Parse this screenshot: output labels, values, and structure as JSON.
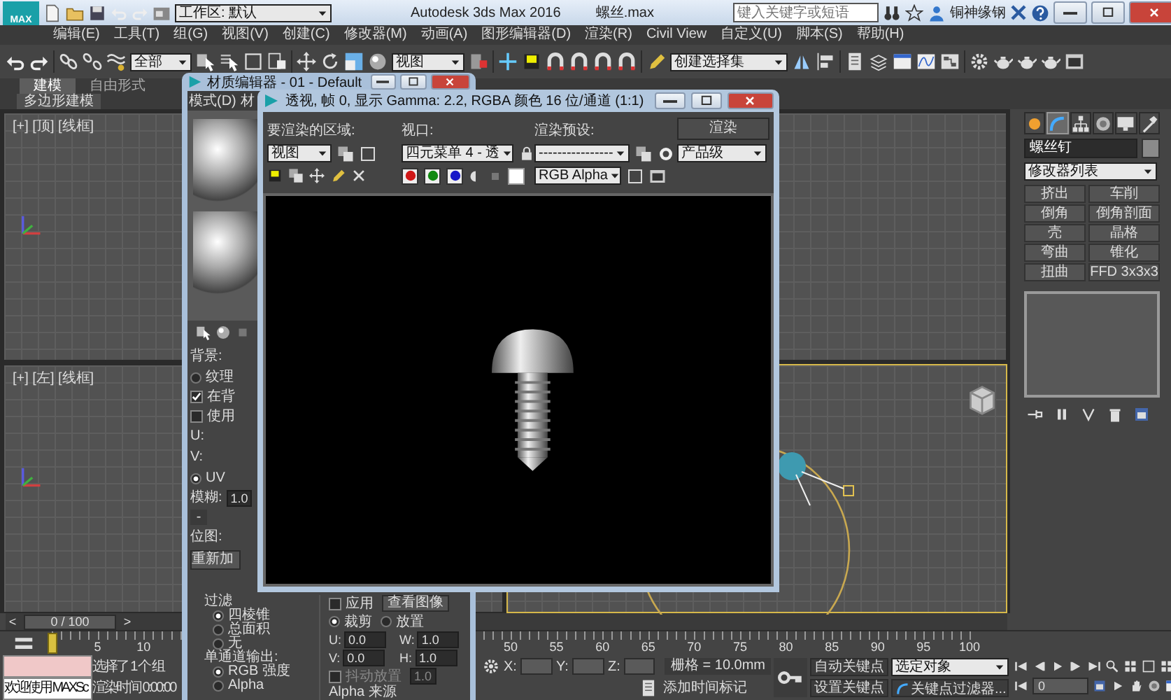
{
  "main_window": {
    "logo": "MAX",
    "workspace": "工作区: 默认",
    "title": "Autodesk 3ds Max 2016",
    "file": "螺丝.max",
    "search": {
      "placeholder": "键入关键字或短语"
    },
    "user": "铜神缘钢",
    "menu": [
      "编辑(E)",
      "工具(T)",
      "组(G)",
      "视图(V)",
      "创建(C)",
      "修改器(M)",
      "动画(A)",
      "图形编辑器(D)",
      "渲染(R)",
      "Civil View",
      "自定义(U)",
      "脚本(S)",
      "帮助(H)"
    ],
    "toolbar": {
      "selection_filter": "全部",
      "reference_coordinate": "视图",
      "named_selection": "创建选择集"
    },
    "ribbon": {
      "tabs": [
        {
          "label": "建模",
          "selected": true
        },
        {
          "label": "自由形式",
          "selected": false
        }
      ],
      "panel": "多边形建模"
    },
    "viewports": [
      {
        "label": "[+] [顶] [线框]",
        "active": false
      },
      {
        "active": false
      },
      {
        "label": "[+] [左] [线框]",
        "active": false
      },
      {
        "active": true
      }
    ],
    "command_panel": {
      "tabs": [
        {
          "selected": false
        },
        {
          "selected": true
        },
        {
          "selected": false
        },
        {
          "selected": false
        },
        {
          "selected": false
        },
        {
          "selected": false
        }
      ],
      "object_name": "螺丝钉",
      "modifier_list": "修改器列表",
      "modifiers": [
        "挤出",
        "车削",
        "倒角",
        "倒角剖面",
        "壳",
        "晶格",
        "弯曲",
        "锥化",
        "扭曲",
        "FFD 3x3x3"
      ]
    },
    "time_slider": {
      "prev": "<",
      "reading": "0 / 100",
      "next": ">",
      "level": 0
    },
    "track_bar": {
      "ticks": [
        "5",
        "10",
        "50",
        "55",
        "60",
        "65",
        "70",
        "75",
        "80",
        "85",
        "90",
        "95",
        "100"
      ]
    },
    "status": {
      "listener_message": "欢迎使用 MAXSc",
      "selection": "选择了 1 个 组",
      "render_time": "渲染时间 0:00:00",
      "coords": [
        "X:",
        "Y:",
        "Z:"
      ],
      "grid": "栅格 = 10.0mm",
      "add_time_tag": "添加时间标记",
      "auto_key": "自动关键点",
      "key_mode": "选定对象",
      "set_key": "设置关键点",
      "key_filters": "关键点过滤器...",
      "current_frame": "0"
    }
  },
  "material_editor": {
    "title": "材质编辑器 - 01 - Default",
    "menu": [
      "模式(D)",
      "材"
    ],
    "params": [
      {
        "kind": "label",
        "text": "背景:"
      },
      {
        "kind": "radio",
        "text": "纹理",
        "selected": false
      },
      {
        "kind": "checkbox",
        "text": "在背",
        "checked": true
      },
      {
        "kind": "checkbox",
        "text": "使用",
        "checked": false
      },
      {
        "kind": "label",
        "text": "U:"
      },
      {
        "kind": "label",
        "text": "V:"
      },
      {
        "kind": "radio",
        "text": "UV",
        "selected": true
      },
      {
        "kind": "spinner",
        "text": "模糊:",
        "value": "1.0"
      },
      {
        "kind": "rollout",
        "text": "-"
      },
      {
        "kind": "label",
        "text": "位图:"
      },
      {
        "kind": "button",
        "text": "重新加"
      }
    ],
    "filtering": {
      "title": "过滤",
      "options": [
        {
          "label": "四棱锥",
          "selected": true
        },
        {
          "label": "总面积",
          "selected": false
        },
        {
          "label": "无",
          "selected": false
        }
      ]
    },
    "mono_output": {
      "title": "单通道输出:",
      "options": [
        {
          "label": "RGB 强度",
          "selected": true
        },
        {
          "label": "Alpha",
          "selected": false
        }
      ]
    },
    "cropping": {
      "apply": {
        "label": "应用",
        "checked": false
      },
      "view_image": "查看图像",
      "modes": [
        {
          "label": "裁剪",
          "selected": true
        },
        {
          "label": "放置",
          "selected": false
        }
      ],
      "spinners": [
        {
          "label": "U:",
          "value": "0.0"
        },
        {
          "label": "W:",
          "value": "1.0"
        },
        {
          "label": "V:",
          "value": "0.0"
        },
        {
          "label": "H:",
          "value": "1.0"
        }
      ],
      "jitter": {
        "label": "抖动放置",
        "checked": false,
        "value": "1.0"
      }
    },
    "alpha_source": {
      "title": "Alpha 来源"
    }
  },
  "render_frame": {
    "title": "透视, 帧 0, 显示 Gamma: 2.2, RGBA 颜色 16 位/通道 (1:1)",
    "area": {
      "label": "要渲染的区域:",
      "value": "视图"
    },
    "viewport": {
      "label": "视口:",
      "value": "四元菜单 4 - 透"
    },
    "preset": {
      "label": "渲染预设:",
      "value": "----------------"
    },
    "render_button": "渲染",
    "quality": "产品级",
    "channels": [
      {
        "color": "#d01818"
      },
      {
        "color": "#108a10"
      },
      {
        "color": "#1818c8"
      }
    ],
    "display": "RGB Alpha"
  }
}
